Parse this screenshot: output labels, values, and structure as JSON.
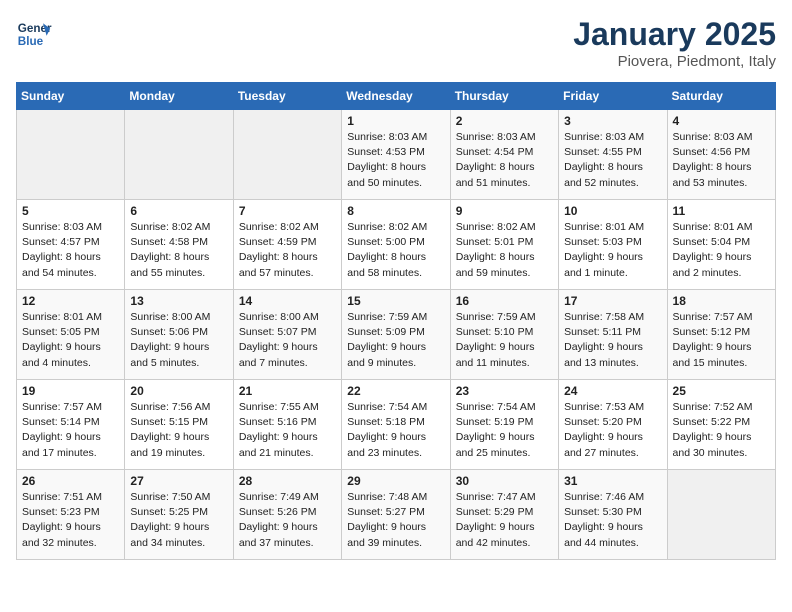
{
  "header": {
    "logo_general": "General",
    "logo_blue": "Blue",
    "title": "January 2025",
    "location": "Piovera, Piedmont, Italy"
  },
  "weekdays": [
    "Sunday",
    "Monday",
    "Tuesday",
    "Wednesday",
    "Thursday",
    "Friday",
    "Saturday"
  ],
  "weeks": [
    [
      {
        "num": "",
        "info": ""
      },
      {
        "num": "",
        "info": ""
      },
      {
        "num": "",
        "info": ""
      },
      {
        "num": "1",
        "info": "Sunrise: 8:03 AM\nSunset: 4:53 PM\nDaylight: 8 hours\nand 50 minutes."
      },
      {
        "num": "2",
        "info": "Sunrise: 8:03 AM\nSunset: 4:54 PM\nDaylight: 8 hours\nand 51 minutes."
      },
      {
        "num": "3",
        "info": "Sunrise: 8:03 AM\nSunset: 4:55 PM\nDaylight: 8 hours\nand 52 minutes."
      },
      {
        "num": "4",
        "info": "Sunrise: 8:03 AM\nSunset: 4:56 PM\nDaylight: 8 hours\nand 53 minutes."
      }
    ],
    [
      {
        "num": "5",
        "info": "Sunrise: 8:03 AM\nSunset: 4:57 PM\nDaylight: 8 hours\nand 54 minutes."
      },
      {
        "num": "6",
        "info": "Sunrise: 8:02 AM\nSunset: 4:58 PM\nDaylight: 8 hours\nand 55 minutes."
      },
      {
        "num": "7",
        "info": "Sunrise: 8:02 AM\nSunset: 4:59 PM\nDaylight: 8 hours\nand 57 minutes."
      },
      {
        "num": "8",
        "info": "Sunrise: 8:02 AM\nSunset: 5:00 PM\nDaylight: 8 hours\nand 58 minutes."
      },
      {
        "num": "9",
        "info": "Sunrise: 8:02 AM\nSunset: 5:01 PM\nDaylight: 8 hours\nand 59 minutes."
      },
      {
        "num": "10",
        "info": "Sunrise: 8:01 AM\nSunset: 5:03 PM\nDaylight: 9 hours\nand 1 minute."
      },
      {
        "num": "11",
        "info": "Sunrise: 8:01 AM\nSunset: 5:04 PM\nDaylight: 9 hours\nand 2 minutes."
      }
    ],
    [
      {
        "num": "12",
        "info": "Sunrise: 8:01 AM\nSunset: 5:05 PM\nDaylight: 9 hours\nand 4 minutes."
      },
      {
        "num": "13",
        "info": "Sunrise: 8:00 AM\nSunset: 5:06 PM\nDaylight: 9 hours\nand 5 minutes."
      },
      {
        "num": "14",
        "info": "Sunrise: 8:00 AM\nSunset: 5:07 PM\nDaylight: 9 hours\nand 7 minutes."
      },
      {
        "num": "15",
        "info": "Sunrise: 7:59 AM\nSunset: 5:09 PM\nDaylight: 9 hours\nand 9 minutes."
      },
      {
        "num": "16",
        "info": "Sunrise: 7:59 AM\nSunset: 5:10 PM\nDaylight: 9 hours\nand 11 minutes."
      },
      {
        "num": "17",
        "info": "Sunrise: 7:58 AM\nSunset: 5:11 PM\nDaylight: 9 hours\nand 13 minutes."
      },
      {
        "num": "18",
        "info": "Sunrise: 7:57 AM\nSunset: 5:12 PM\nDaylight: 9 hours\nand 15 minutes."
      }
    ],
    [
      {
        "num": "19",
        "info": "Sunrise: 7:57 AM\nSunset: 5:14 PM\nDaylight: 9 hours\nand 17 minutes."
      },
      {
        "num": "20",
        "info": "Sunrise: 7:56 AM\nSunset: 5:15 PM\nDaylight: 9 hours\nand 19 minutes."
      },
      {
        "num": "21",
        "info": "Sunrise: 7:55 AM\nSunset: 5:16 PM\nDaylight: 9 hours\nand 21 minutes."
      },
      {
        "num": "22",
        "info": "Sunrise: 7:54 AM\nSunset: 5:18 PM\nDaylight: 9 hours\nand 23 minutes."
      },
      {
        "num": "23",
        "info": "Sunrise: 7:54 AM\nSunset: 5:19 PM\nDaylight: 9 hours\nand 25 minutes."
      },
      {
        "num": "24",
        "info": "Sunrise: 7:53 AM\nSunset: 5:20 PM\nDaylight: 9 hours\nand 27 minutes."
      },
      {
        "num": "25",
        "info": "Sunrise: 7:52 AM\nSunset: 5:22 PM\nDaylight: 9 hours\nand 30 minutes."
      }
    ],
    [
      {
        "num": "26",
        "info": "Sunrise: 7:51 AM\nSunset: 5:23 PM\nDaylight: 9 hours\nand 32 minutes."
      },
      {
        "num": "27",
        "info": "Sunrise: 7:50 AM\nSunset: 5:25 PM\nDaylight: 9 hours\nand 34 minutes."
      },
      {
        "num": "28",
        "info": "Sunrise: 7:49 AM\nSunset: 5:26 PM\nDaylight: 9 hours\nand 37 minutes."
      },
      {
        "num": "29",
        "info": "Sunrise: 7:48 AM\nSunset: 5:27 PM\nDaylight: 9 hours\nand 39 minutes."
      },
      {
        "num": "30",
        "info": "Sunrise: 7:47 AM\nSunset: 5:29 PM\nDaylight: 9 hours\nand 42 minutes."
      },
      {
        "num": "31",
        "info": "Sunrise: 7:46 AM\nSunset: 5:30 PM\nDaylight: 9 hours\nand 44 minutes."
      },
      {
        "num": "",
        "info": ""
      }
    ]
  ]
}
